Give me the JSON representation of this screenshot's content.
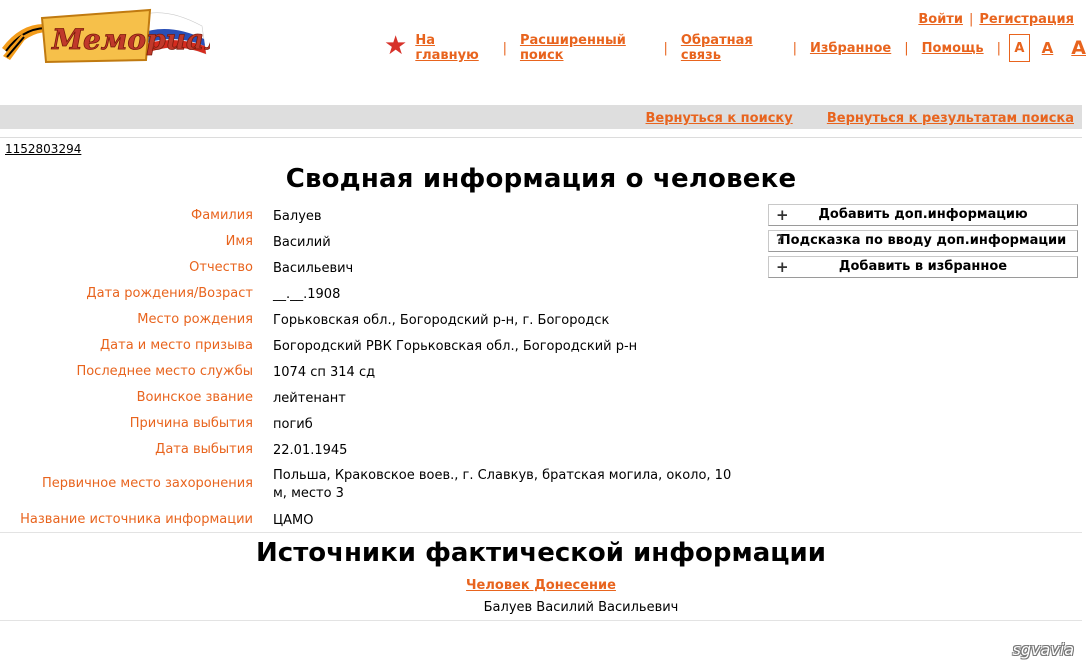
{
  "header": {
    "logo_text": "Мемориал",
    "auth": {
      "login": "Войти",
      "register": "Регистрация"
    },
    "nav": [
      "На главную",
      "Расширенный поиск",
      "Обратная связь",
      "Избранное",
      "Помощь"
    ],
    "font_sizes": [
      "A",
      "A",
      "A"
    ]
  },
  "backbar": {
    "to_search": "Вернуться к поиску",
    "to_results": "Вернуться к результатам поиска"
  },
  "record_id": "1152803294",
  "summary": {
    "title": "Сводная информация о человеке",
    "fields": [
      {
        "label": "Фамилия",
        "value": "Балуев"
      },
      {
        "label": "Имя",
        "value": "Василий"
      },
      {
        "label": "Отчество",
        "value": "Васильевич"
      },
      {
        "label": "Дата рождения/Возраст",
        "value": "__.__.1908"
      },
      {
        "label": "Место рождения",
        "value": "Горьковская обл., Богородский р-н, г. Богородск"
      },
      {
        "label": "Дата и место призыва",
        "value": "Богородский РВК Горьковская обл., Богородский р-н"
      },
      {
        "label": "Последнее место службы",
        "value": "1074 сп 314 сд"
      },
      {
        "label": "Воинское звание",
        "value": "лейтенант"
      },
      {
        "label": "Причина выбытия",
        "value": "погиб"
      },
      {
        "label": "Дата выбытия",
        "value": "22.01.1945"
      },
      {
        "label": "Первичное место захоронения",
        "value": "Польша, Краковское воев., г. Славкув, братская могила, около, 10 м, место 3"
      },
      {
        "label": "Название источника информации",
        "value": "ЦАМО"
      }
    ]
  },
  "actions": [
    {
      "icon": "+",
      "label": "Добавить доп.информацию"
    },
    {
      "icon": "?",
      "label": "Подсказка по вводу доп.информации"
    },
    {
      "icon": "+",
      "label": "Добавить в избранное"
    }
  ],
  "sources": {
    "title": "Источники фактической информации",
    "doc_link": "Человек Донесение",
    "person": "Балуев Василий Васильевич"
  },
  "watermark": "sgvavia",
  "colors": {
    "accent": "#e8641e",
    "star": "#d7322a",
    "bar": "#dedede"
  }
}
